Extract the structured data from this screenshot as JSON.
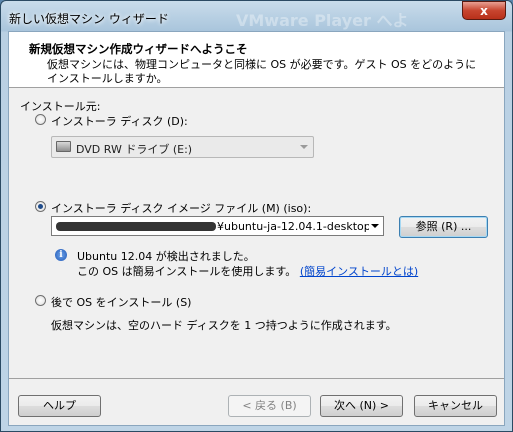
{
  "window": {
    "title": "新しい仮想マシン ウィザード",
    "background_title": "VMware Player へよ",
    "close_label": "x"
  },
  "header": {
    "title": "新規仮想マシン作成ウィザードへようこそ",
    "description": "仮想マシンには、物理コンピュータと同様に OS が必要です。ゲスト OS をどのようにインストールしますか。"
  },
  "install_source": {
    "label": "インストール元:",
    "disc_option": {
      "label": "インストーラ ディスク (D):",
      "selected": false,
      "drive_value": "DVD RW ドライブ (E:)"
    },
    "iso_option": {
      "label": "インストーラ ディスク イメージ ファイル (M) (iso):",
      "selected": true,
      "path_value": "C:\\Users\\xxxxxxxx\\Downloads\\ubuntu-ja-12.04.1-desktop",
      "visible_path_suffix": "¥ubuntu-ja-12.04.1-desktop",
      "browse_label": "参照 (R) ...",
      "detected_text": "Ubuntu 12.04 が検出されました。",
      "easy_install_text": "この OS は簡易インストールを使用します。",
      "easy_install_link": "(簡易インストールとは)"
    },
    "later_option": {
      "label": "後で OS をインストール (S)",
      "selected": false,
      "description": "仮想マシンは、空のハード ディスクを 1 つ持つように作成されます。"
    }
  },
  "footer": {
    "help_label": "ヘルプ",
    "back_label": "< 戻る (B)",
    "next_label": "次へ (N) >",
    "cancel_label": "キャンセル"
  },
  "colors": {
    "accent": "#1f4b8a",
    "link": "#0044cc",
    "close_button": "#c7452f"
  }
}
